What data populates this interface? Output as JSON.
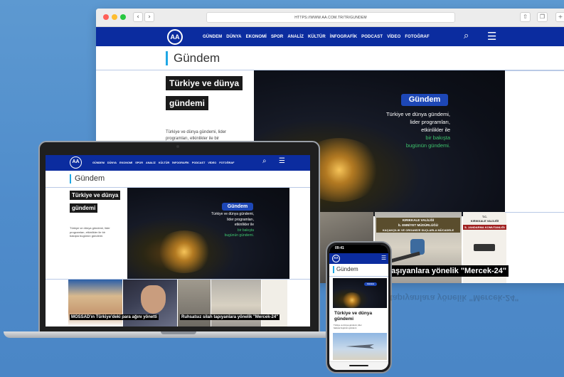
{
  "browser": {
    "url": "HTTPS://WWW.AA.COM.TR/TR/GUNDEM",
    "back": "‹",
    "forward": "›",
    "share_icon": "share-icon",
    "tabs_icon": "tabs-icon"
  },
  "site": {
    "logo": "AA",
    "menu": [
      "GÜNDEM",
      "DÜNYA",
      "EKONOMİ",
      "SPOR",
      "ANALİZ",
      "KÜLTÜR",
      "İNFOGRAFİK",
      "PODCAST",
      "VİDEO",
      "FOTOĞRAF"
    ],
    "search_icon": "⌕",
    "menu_icon": "☰",
    "page_title": "Gündem",
    "hero_title_1": "Türkiye ve dünya",
    "hero_title_2": "gündemi",
    "hero_desc_1": "Türkiye ve dünya gündemi, lider",
    "hero_desc_2": "programları, etkinlikler ile bir",
    "hero_desc_full_1": "Türkiye ve dünya gündemi, lider",
    "hero_desc_full_2": "programları, etkinlikler ile bir",
    "hero_desc_full_3": "bakışta bugünün gündemi.",
    "banner_badge": "Gündem",
    "banner_line1": "Türkiye ve dünya gündemi,",
    "banner_line2": "lider programları,",
    "banner_line3": "etkinlikler ile",
    "banner_line4": "bir bakışta",
    "banner_line5": "bugünün gündemi.",
    "news_1": "MOSSAD'ın Türkiye'deki para ağını yönetti",
    "news_2": "Ruhsatsız silah tapıyanlara yönelik \"Mercek-24\"",
    "news_2_short": "aşıyanlara yönelik \"Mercek-24\"",
    "sign_1": "KIRIKKALE VALİLİĞİ",
    "sign_2": "İL EMNİYET MÜDÜRLÜĞÜ",
    "sign_3": "KAÇAKÇILIK VE ORGANİZE SUÇLARLA MÜCADELE",
    "sign_4": "KIRIKKALE VALİLİĞİ",
    "sign_5": "İL JANDARMA KOMUTANLIĞI",
    "sign_tc": "T.C."
  },
  "phone": {
    "time": "09:41",
    "reflection_text": "tapıyanlara yönelik \"Mercek-24\""
  },
  "colors": {
    "nav_blue": "#0b2c9f",
    "accent_cyan": "#20a8e5",
    "badge_blue": "#1d47b6",
    "green_text": "#3ec46d",
    "background": "#5d99d1"
  }
}
